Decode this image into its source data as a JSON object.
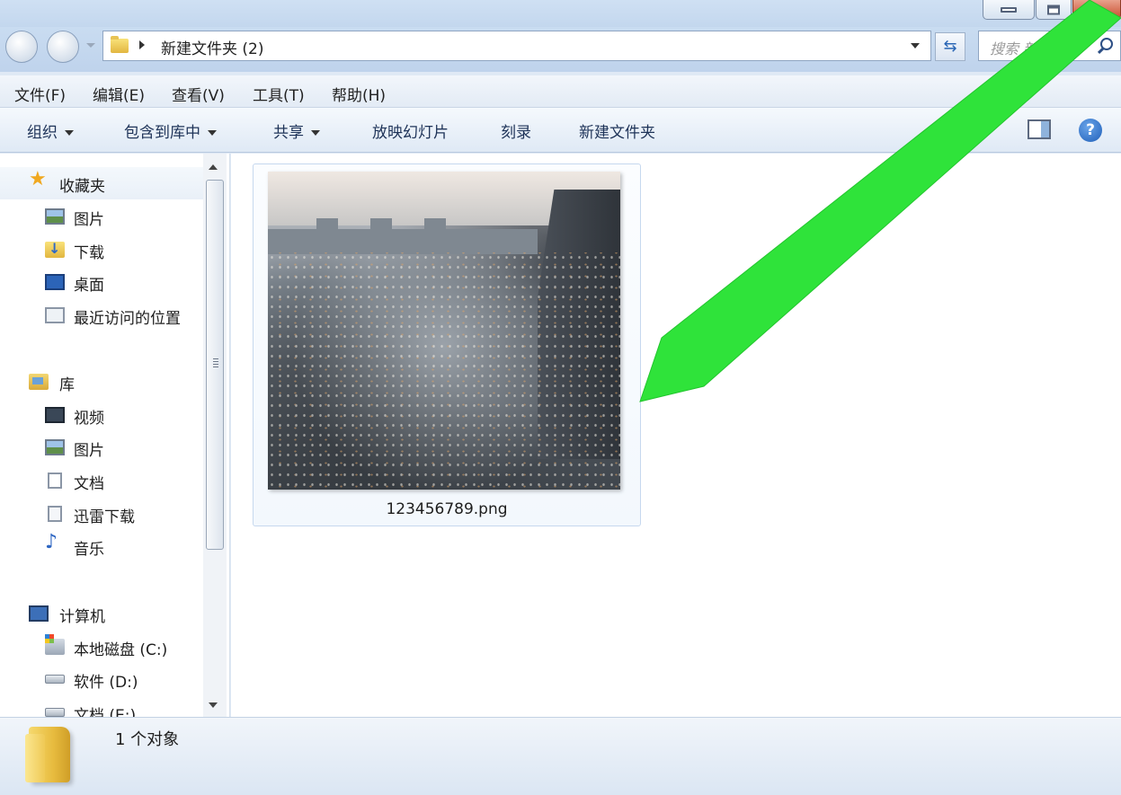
{
  "window": {
    "breadcrumb": "新建文件夹 (2)",
    "search_placeholder": "搜索 新建..."
  },
  "menu": [
    {
      "label": "文件(F)"
    },
    {
      "label": "编辑(E)"
    },
    {
      "label": "查看(V)"
    },
    {
      "label": "工具(T)"
    },
    {
      "label": "帮助(H)"
    }
  ],
  "toolbar": {
    "organize": "组织",
    "include_in_library": "包含到库中",
    "share": "共享",
    "slideshow": "放映幻灯片",
    "burn": "刻录",
    "new_folder": "新建文件夹",
    "help_glyph": "?"
  },
  "nav": {
    "favorites": {
      "label": "收藏夹",
      "icon": "star-icon",
      "items": [
        {
          "label": "图片",
          "icon": "pictures-icon"
        },
        {
          "label": "下载",
          "icon": "downloads-icon"
        },
        {
          "label": "桌面",
          "icon": "desktop-icon"
        },
        {
          "label": "最近访问的位置",
          "icon": "recent-places-icon"
        }
      ]
    },
    "libraries": {
      "label": "库",
      "icon": "library-icon",
      "items": [
        {
          "label": "视频",
          "icon": "video-icon"
        },
        {
          "label": "图片",
          "icon": "pictures-icon"
        },
        {
          "label": "文档",
          "icon": "documents-icon"
        },
        {
          "label": "迅雷下载",
          "icon": "thunder-download-icon"
        },
        {
          "label": "音乐",
          "icon": "music-icon"
        }
      ]
    },
    "computer": {
      "label": "计算机",
      "icon": "computer-icon",
      "items": [
        {
          "label": "本地磁盘 (C:)",
          "icon": "local-disk-icon"
        },
        {
          "label": "软件 (D:)",
          "icon": "drive-icon"
        },
        {
          "label": "文档 (E:)",
          "icon": "drive-icon"
        }
      ]
    }
  },
  "files": [
    {
      "name": "123456789.png"
    }
  ],
  "status": {
    "text": "1 个对象"
  },
  "colors": {
    "annotation_arrow": "#2fe33a",
    "window_frame": "#c6d9ef"
  }
}
